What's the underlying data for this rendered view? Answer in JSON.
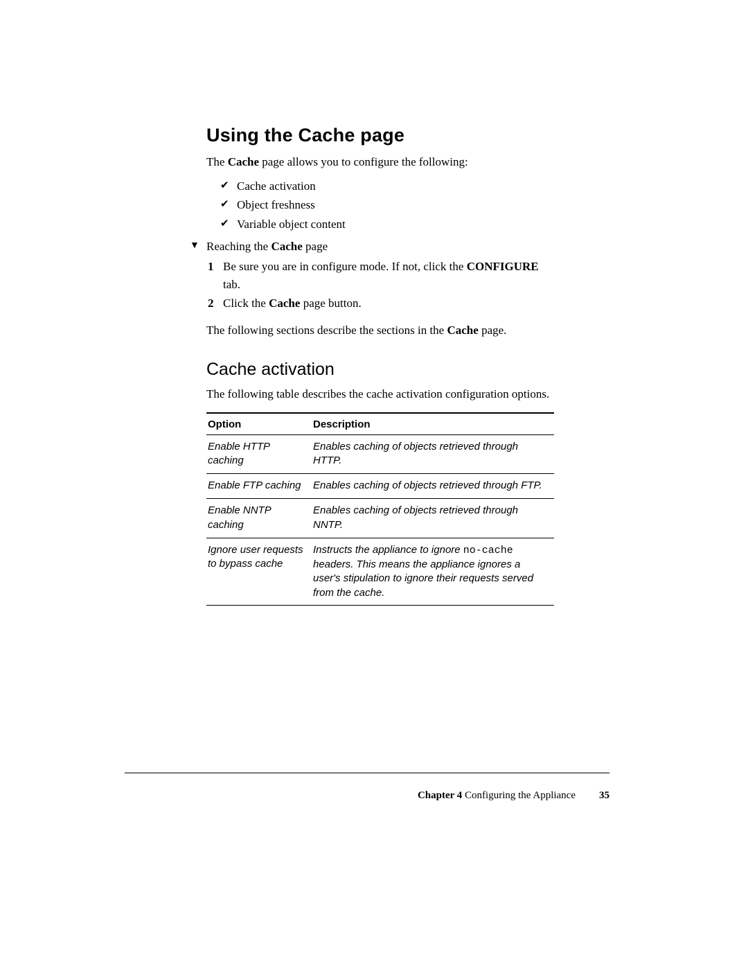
{
  "heading1": "Using the Cache page",
  "intro": {
    "pre": "The ",
    "bold": "Cache",
    "post": " page allows you to configure the following:"
  },
  "bullets": [
    "Cache activation",
    "Object freshness",
    "Variable object content"
  ],
  "procedure": {
    "lead_pre": "Reaching the ",
    "lead_bold": "Cache",
    "lead_post": " page",
    "steps": [
      {
        "pre": "Be sure you are in configure mode. If not, click the ",
        "bold": "CONFIGURE",
        "post": " tab."
      },
      {
        "pre": "Click the ",
        "bold": "Cache",
        "post": " page button."
      }
    ]
  },
  "after_steps": {
    "pre": "The following sections describe the sections in the ",
    "bold": "Cache",
    "post": " page."
  },
  "heading2": "Cache activation",
  "table_intro": "The following table describes the cache activation configuration options.",
  "table": {
    "headers": {
      "option": "Option",
      "description": "Description"
    },
    "rows": [
      {
        "option": "Enable HTTP caching",
        "desc_pre": "Enables caching of objects retrieved through HTTP.",
        "code": "",
        "desc_post": ""
      },
      {
        "option": "Enable FTP caching",
        "desc_pre": "Enables caching of objects retrieved through FTP.",
        "code": "",
        "desc_post": ""
      },
      {
        "option": "Enable NNTP caching",
        "desc_pre": "Enables caching of objects retrieved through NNTP.",
        "code": "",
        "desc_post": ""
      },
      {
        "option": "Ignore user requests to bypass cache",
        "desc_pre": "Instructs the appliance to ignore ",
        "code": "no-cache",
        "desc_post": " headers. This means the appliance ignores a user's stipulation to ignore their requests served from the cache."
      }
    ]
  },
  "footer": {
    "chapter_label": "Chapter 4",
    "chapter_title": "  Configuring the Appliance",
    "page_number": "35"
  }
}
